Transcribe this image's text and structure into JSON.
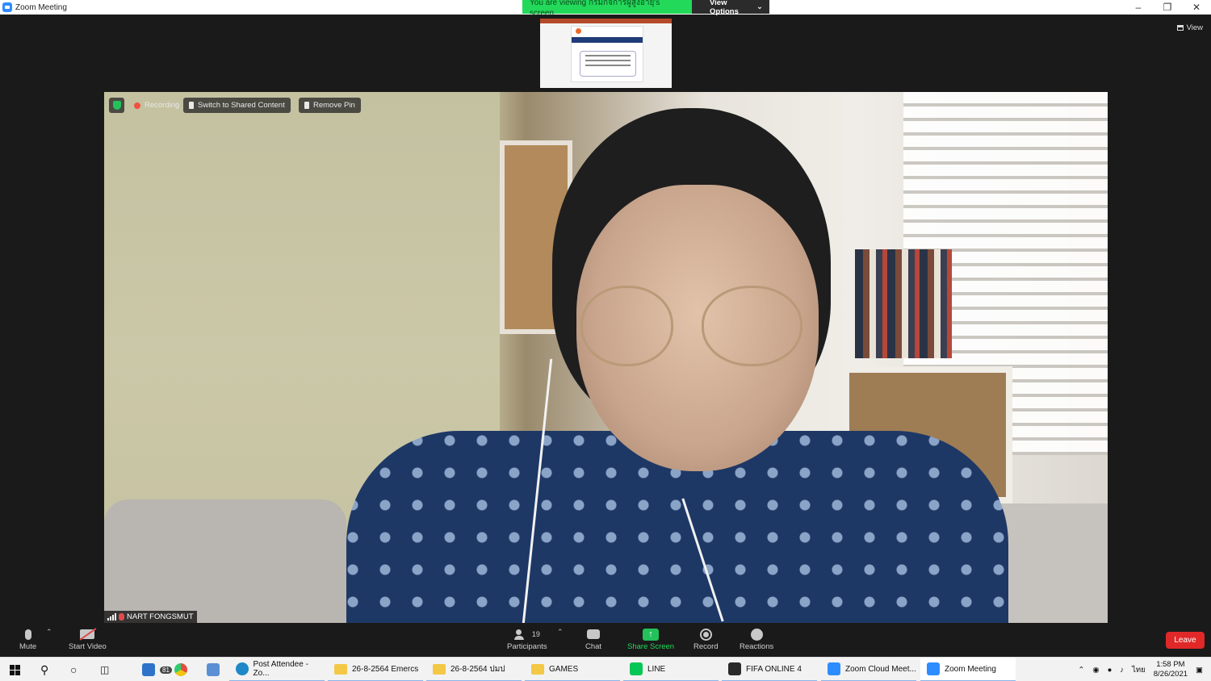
{
  "window": {
    "title": "Zoom Meeting"
  },
  "banner": {
    "viewing_text": "You are viewing กรมกิจการผู้สูงอายุ's screen",
    "view_options": "View Options"
  },
  "view_button": "View",
  "overlay": {
    "recording": "Recording",
    "switch_shared": "Switch to Shared Content",
    "remove_pin": "Remove Pin"
  },
  "participant": {
    "name": "NART FONGSMUT"
  },
  "toolbar": {
    "mute": "Mute",
    "start_video": "Start Video",
    "participants": "Participants",
    "participant_count": "19",
    "chat": "Chat",
    "share_screen": "Share Screen",
    "record": "Record",
    "reactions": "Reactions",
    "leave": "Leave"
  },
  "taskbar": {
    "apps": [
      {
        "label": "Post Attendee - Zo..."
      },
      {
        "label": "26-8-2564 Emercs"
      },
      {
        "label": "26-8-2564 ปมป"
      },
      {
        "label": "GAMES"
      },
      {
        "label": "LINE"
      },
      {
        "label": "FIFA ONLINE 4"
      },
      {
        "label": "Zoom Cloud Meet..."
      },
      {
        "label": "Zoom Meeting"
      }
    ],
    "mail_badge": "81",
    "lang": "ไทย",
    "time": "1:58 PM",
    "date": "8/26/2021"
  },
  "colors": {
    "zoom_green": "#23d959",
    "leave_red": "#e02828",
    "zoom_blue": "#2d8cff"
  }
}
